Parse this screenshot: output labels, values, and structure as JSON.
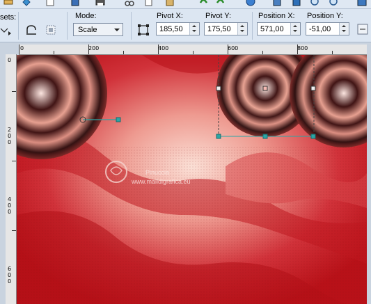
{
  "toolbar": {
    "presets_label": "sets:",
    "mode_label": "Mode:",
    "mode_value": "Scale",
    "pivot_x_label": "Pivot X:",
    "pivot_x_value": "185,50",
    "pivot_y_label": "Pivot Y:",
    "pivot_y_value": "175,50",
    "position_x_label": "Position X:",
    "position_x_value": "571,00",
    "position_y_label": "Position Y:",
    "position_y_value": "-51,00"
  },
  "ruler": {
    "h_labels": [
      "0",
      "200",
      "400",
      "600",
      "800"
    ],
    "v_labels": [
      "0",
      "2\n0\n0",
      "4\n0\n0",
      "6\n0\n0"
    ]
  },
  "watermark": {
    "line1": "Pinuccia",
    "line2": "www.maildigrafica.eu"
  },
  "colors": {
    "accent_handle": "#2aa6a6",
    "canvas_red": "#c8161b",
    "canvas_pink": "#f6c9bd"
  }
}
